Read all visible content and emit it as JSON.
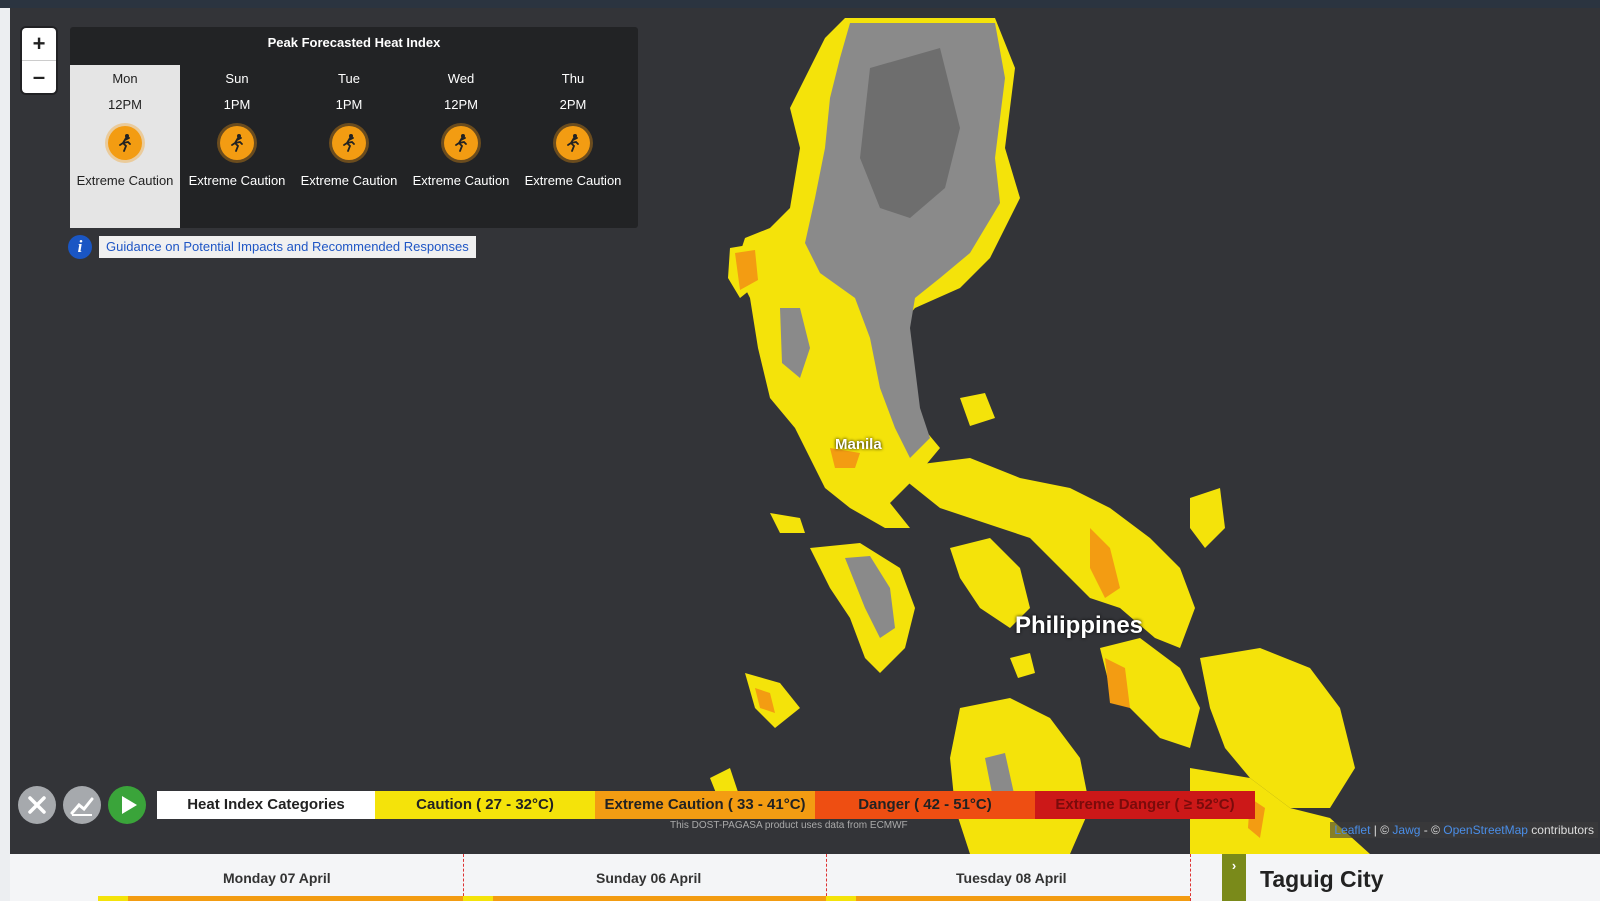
{
  "panel": {
    "title": "Peak Forecasted Heat Index",
    "days": [
      {
        "day": "Mon",
        "time": "12PM",
        "level": "Extreme Caution",
        "active": true
      },
      {
        "day": "Sun",
        "time": "1PM",
        "level": "Extreme Caution",
        "active": false
      },
      {
        "day": "Tue",
        "time": "1PM",
        "level": "Extreme Caution",
        "active": false
      },
      {
        "day": "Wed",
        "time": "12PM",
        "level": "Extreme Caution",
        "active": false
      },
      {
        "day": "Thu",
        "time": "2PM",
        "level": "Extreme Caution",
        "active": false
      }
    ]
  },
  "zoom": {
    "in": "+",
    "out": "–"
  },
  "guidance": {
    "info": "i",
    "link": "Guidance on Potential Impacts and Recommended Responses"
  },
  "map": {
    "country_label": "Philippines",
    "city_label": "Manila",
    "product_note": "This DOST-PAGASA product uses data from ECMWF",
    "attribution": {
      "leaflet": "Leaflet",
      "sep1": " | © ",
      "jawg": "Jawg",
      "sep2": " - © ",
      "osm": "OpenStreetMap",
      "tail": " contributors"
    }
  },
  "legend": {
    "title": "Heat Index Categories",
    "items": [
      {
        "label": "Caution ( 27 - 32°C)",
        "color": "#f4e30a",
        "text_color": "#222"
      },
      {
        "label": "Extreme Caution ( 33 - 41°C)",
        "color": "#f39c12",
        "text_color": "#222"
      },
      {
        "label": "Danger ( 42 - 51°C)",
        "color": "#ee4e12",
        "text_color": "#222"
      },
      {
        "label": "Extreme Danger ( ≥ 52°C)",
        "color": "#cc1818",
        "text_color": "#7a0b0b"
      }
    ]
  },
  "controls": {
    "close": "close-icon",
    "chart": "chart-icon",
    "play": "play-icon"
  },
  "timeline": {
    "dates": [
      "Monday 07 April",
      "Sunday 06 April",
      "Tuesday 08 April"
    ],
    "side_button": "›",
    "location": "Taguig City"
  },
  "colors": {
    "caution": "#f4e30a",
    "extreme_caution": "#f39c12",
    "map_bg": "#333438",
    "terrain": "#8a8a8a"
  }
}
